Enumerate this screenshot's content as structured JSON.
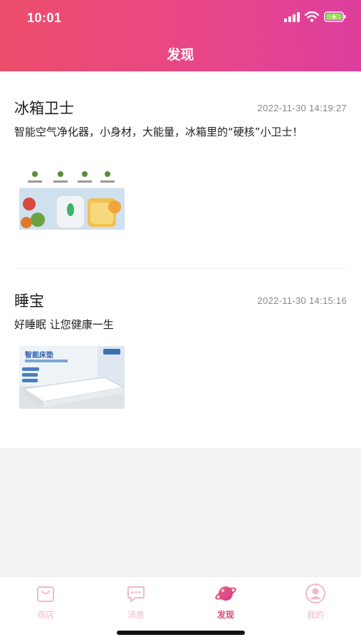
{
  "status_bar": {
    "time": "10:01"
  },
  "header": {
    "title": "发现"
  },
  "posts": [
    {
      "title": "冰箱卫士",
      "time": "2022-11-30 14:19:27",
      "description": "智能空气净化器，小身材，大能量，冰箱里的“硬核”小卫士！",
      "image_icon": "fridge-purifier-product-image"
    },
    {
      "title": "睡宝",
      "time": "2022-11-30 14:15:16",
      "description": "好睡眠 让您健康一生",
      "image_icon": "smart-mattress-product-image",
      "image_caption": "智能床垫"
    }
  ],
  "tabbar": {
    "items": [
      {
        "label": "商店",
        "icon": "shop-bag-icon",
        "active": false
      },
      {
        "label": "消息",
        "icon": "message-icon",
        "active": false
      },
      {
        "label": "发现",
        "icon": "planet-icon",
        "active": true
      },
      {
        "label": "我的",
        "icon": "user-icon",
        "active": false
      }
    ]
  },
  "colors": {
    "accent": "#e44b7a",
    "header_start": "#ec4d6a",
    "header_end": "#dc3e9d",
    "inactive_tab": "#f3b8c6"
  }
}
